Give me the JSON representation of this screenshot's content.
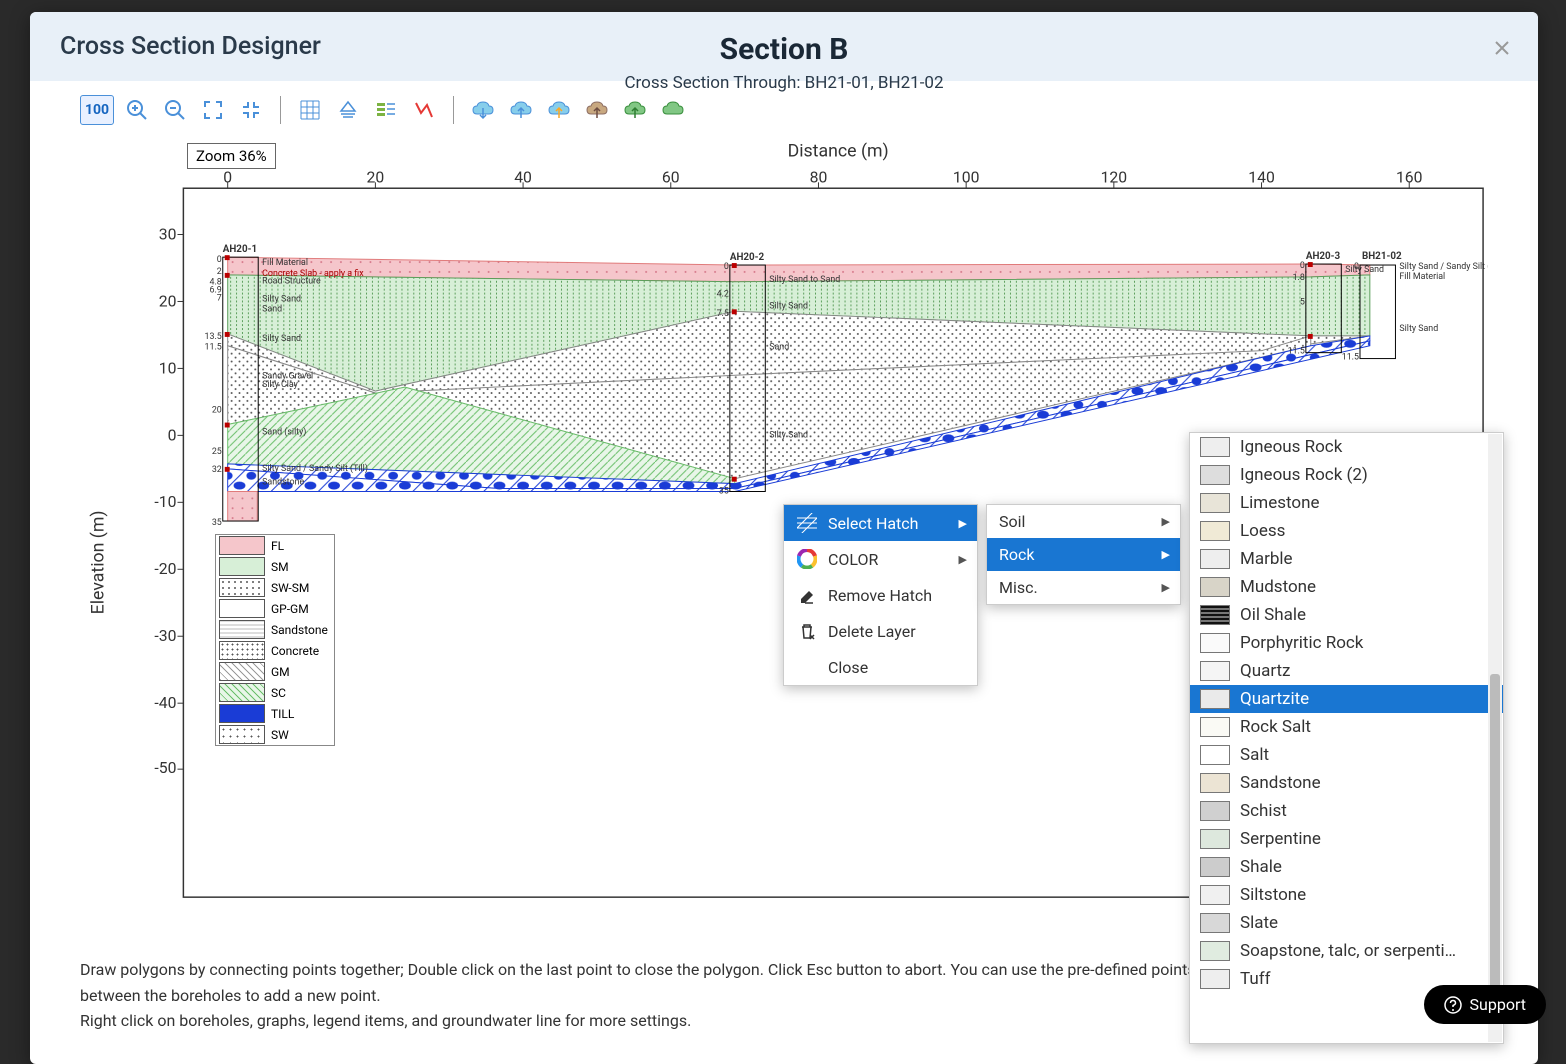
{
  "header": {
    "designer_title": "Cross Section Designer",
    "section_title": "Section B",
    "section_sub": "Cross Section Through: BH21-01, BH21-02"
  },
  "toolbar": {
    "zoom_badge": "Zoom 36%",
    "zoom_value": "100"
  },
  "chart_data": {
    "type": "cross_section",
    "xlabel": "Distance (m)",
    "ylabel": "Elevation (m)",
    "x_ticks": [
      0,
      20,
      40,
      60,
      80,
      100,
      120,
      140,
      160
    ],
    "y_ticks": [
      30,
      20,
      10,
      0,
      -10,
      -20,
      -30,
      -40,
      -50
    ],
    "boreholes": [
      {
        "name": "AH20-1",
        "depths": [
          0,
          2,
          4.8,
          6.9,
          7,
          13.5,
          11.5,
          20,
          25,
          32,
          35
        ]
      },
      {
        "name": "AH20-2",
        "depths": [
          0,
          4.2,
          7.5,
          35
        ]
      },
      {
        "name": "AH20-3",
        "depths": [
          0,
          1.8,
          5,
          11.5
        ]
      },
      {
        "name": "BH21-02",
        "depths": [
          0,
          11.5
        ]
      }
    ],
    "strata_labels": [
      "Fill Material",
      "Concrete Slab - apply a fix",
      "Road Structure",
      "Silty Sand",
      "Sand",
      "Silty Sand",
      "Sandy Gravel",
      "Silty Clay",
      "Sand (silty)",
      "Silty Sand / Sandy Silt (Till)",
      "Sandstone",
      "Silty Sand to Sand",
      "Silty Sand",
      "Sand",
      "Silty Sand / Sandy Silt (Fill)",
      "Fill Material",
      "Silty Sand",
      "Silty Sand"
    ]
  },
  "legend": {
    "items": [
      "FL",
      "SM",
      "SW-SM",
      "GP-GM",
      "Sandstone",
      "Concrete",
      "GM",
      "SC",
      "TILL",
      "SW"
    ]
  },
  "context_menu": {
    "items": [
      {
        "label": "Select Hatch",
        "has_arrow": true
      },
      {
        "label": "COLOR",
        "has_arrow": true
      },
      {
        "label": "Remove Hatch",
        "has_arrow": false
      },
      {
        "label": "Delete Layer",
        "has_arrow": false
      },
      {
        "label": "Close",
        "has_arrow": false
      }
    ]
  },
  "submenu": {
    "items": [
      "Soil",
      "Rock",
      "Misc."
    ]
  },
  "rock_list": {
    "items": [
      "Igneous Rock",
      "Igneous Rock (2)",
      "Limestone",
      "Loess",
      "Marble",
      "Mudstone",
      "Oil Shale",
      "Porphyritic Rock",
      "Quartz",
      "Quartzite",
      "Rock Salt",
      "Salt",
      "Sandstone",
      "Schist",
      "Serpentine",
      "Shale",
      "Siltstone",
      "Slate",
      "Soapstone, talc, or serpenti…",
      "Tuff"
    ],
    "selected": "Quartzite"
  },
  "footer": {
    "line1": "Draw polygons by connecting points together; Double click on the last point to close the polygon. Click Esc button to abort. You can use the pre-defined points (red squares) or click anywhere in between the boreholes to add a new point.",
    "line2": "Right click on boreholes, graphs, legend items, and groundwater line for more settings."
  },
  "support": {
    "label": "Support"
  }
}
